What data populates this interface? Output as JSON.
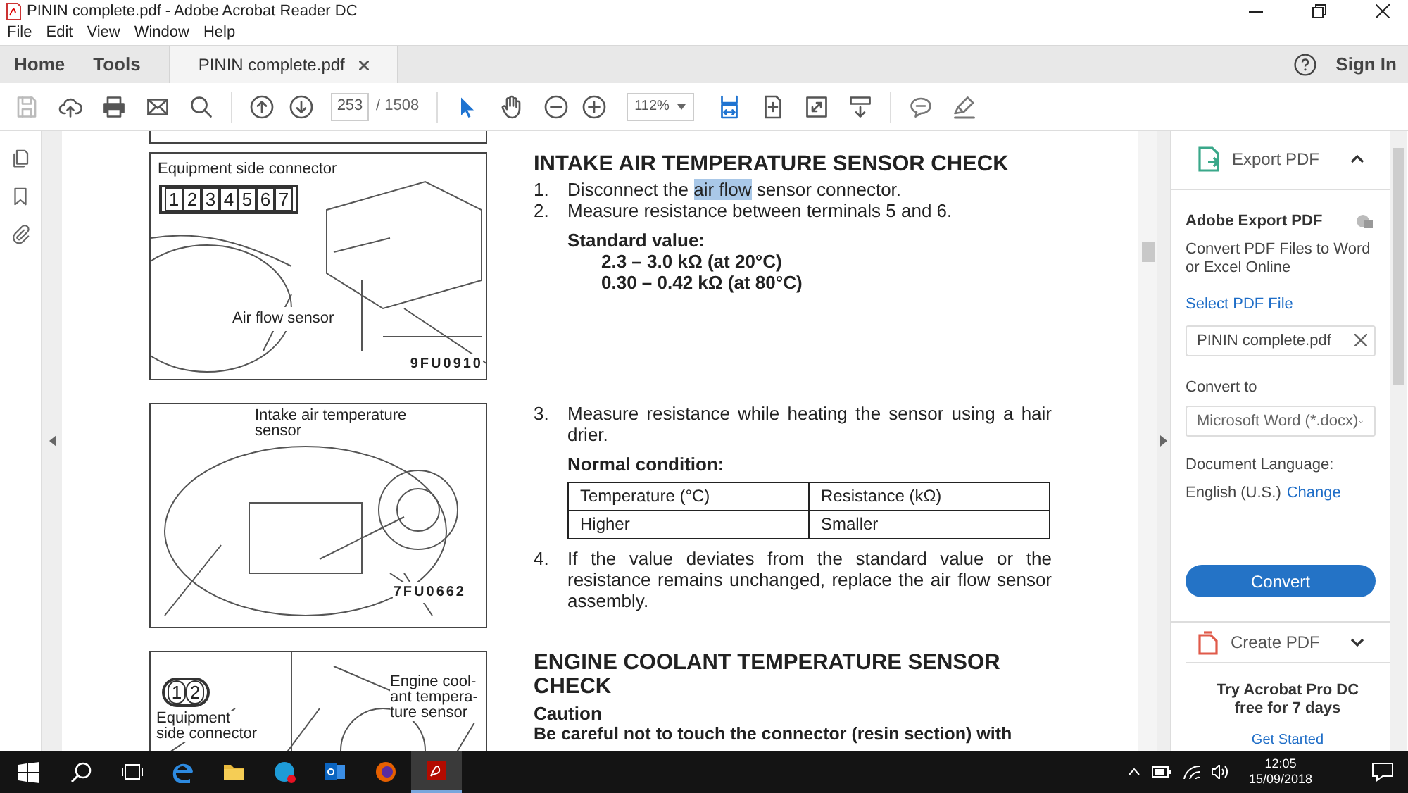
{
  "window": {
    "title": "PININ complete.pdf - Adobe Acrobat Reader DC"
  },
  "menu": [
    "File",
    "Edit",
    "View",
    "Window",
    "Help"
  ],
  "tabs": [
    {
      "label": "Home",
      "selected": false
    },
    {
      "label": "Tools",
      "selected": false
    },
    {
      "label": "PININ complete.pdf",
      "selected": true
    }
  ],
  "account": {
    "sign_in": "Sign In"
  },
  "toolbar": {
    "file_tools": [
      {
        "kind": "save",
        "disabled": true
      },
      {
        "kind": "upload",
        "disabled": false
      },
      {
        "kind": "print",
        "disabled": false
      },
      {
        "kind": "mail",
        "disabled": false
      },
      {
        "kind": "search",
        "disabled": false
      }
    ],
    "nav_tools": [
      {
        "kind": "up"
      },
      {
        "kind": "down"
      }
    ],
    "page": "253",
    "page_count": "/ 1508",
    "pointer_tools": [
      {
        "kind": "select",
        "selected": true
      },
      {
        "kind": "hand",
        "selected": false
      }
    ],
    "zoom_tools": [
      {
        "kind": "zoom-out"
      },
      {
        "kind": "zoom-in"
      }
    ],
    "zoom": "112%",
    "view_tools": [
      {
        "kind": "fit-width",
        "selected": true
      },
      {
        "kind": "fit-page",
        "selected": false
      },
      {
        "kind": "full-screen",
        "selected": false
      },
      {
        "kind": "scroll",
        "selected": false
      }
    ],
    "markup_tools": [
      {
        "kind": "comment"
      },
      {
        "kind": "highlight"
      }
    ]
  },
  "left_rail": [
    {
      "kind": "pages"
    },
    {
      "kind": "bookmark"
    },
    {
      "kind": "attachment"
    }
  ],
  "document": {
    "sections": [
      {
        "figure": {
          "labels": [
            "Equipment side connector",
            "Air flow sensor"
          ],
          "pins": [
            "1",
            "2",
            "3",
            "4",
            "5",
            "6",
            "7"
          ],
          "code": "9FU0910"
        },
        "heading": "INTAKE AIR TEMPERATURE SENSOR CHECK",
        "blocks": [
          {
            "kind": "step",
            "number": "1.",
            "parts": [
              {
                "text": "Disconnect the ",
                "highlighted": false
              },
              {
                "text": "air flow",
                "highlighted": true
              },
              {
                "text": " sensor connector.",
                "highlighted": false
              }
            ]
          },
          {
            "kind": "step",
            "number": "2.",
            "parts": [
              {
                "text": "Measure resistance between terminals 5 and 6.",
                "highlighted": false
              }
            ]
          },
          {
            "kind": "label",
            "text": "Standard value:"
          },
          {
            "kind": "value",
            "text": "2.3 – 3.0 kΩ (at 20°C)"
          },
          {
            "kind": "value",
            "text": "0.30 – 0.42 kΩ (at 80°C)"
          }
        ]
      },
      {
        "figure": {
          "labels": [
            "Intake air temperature\nsensor"
          ],
          "code": "7FU0662"
        },
        "blocks": [
          {
            "kind": "step",
            "number": "3.",
            "parts": [
              {
                "text": "Measure resistance while heating the sensor using a hair drier.",
                "highlighted": false
              }
            ]
          },
          {
            "kind": "label",
            "text": "Normal condition:"
          },
          {
            "kind": "table",
            "rows": [
              [
                "Temperature (°C)",
                "Resistance (kΩ)"
              ],
              [
                "Higher",
                "Smaller"
              ]
            ]
          },
          {
            "kind": "step",
            "number": "4.",
            "parts": [
              {
                "text": "If the value deviates from the standard value or the resistance remains unchanged, replace the air flow sensor assembly.",
                "highlighted": false
              }
            ]
          }
        ]
      },
      {
        "figure": {
          "labels": [
            "Equipment\nside connector",
            "Engine cool-\nant tempera-\nture sensor"
          ],
          "pins": [
            "1",
            "2"
          ]
        },
        "heading": "ENGINE COOLANT TEMPERATURE SENSOR CHECK",
        "blocks": [
          {
            "kind": "label",
            "text": "Caution"
          },
          {
            "kind": "caution",
            "text": "Be careful not to touch the connector (resin section) with"
          }
        ]
      }
    ]
  },
  "panel": {
    "export": {
      "title": "Export PDF",
      "expanded": true,
      "heading": "Adobe Export PDF",
      "description": "Convert PDF Files to Word or Excel Online",
      "select_link": "Select PDF File",
      "file": "PININ complete.pdf",
      "convert_to_label": "Convert to",
      "format": "Microsoft Word (*.docx)",
      "language_label": "Document Language:",
      "language": "English (U.S.)",
      "change_link": "Change",
      "button": "Convert"
    },
    "create": {
      "title": "Create PDF",
      "expanded": false
    },
    "promo": {
      "text": "Try Acrobat Pro DC free for 7 days",
      "link": "Get Started"
    }
  },
  "taskbar": {
    "apps": [
      {
        "kind": "search",
        "selected": false
      },
      {
        "kind": "task-view",
        "selected": false
      },
      {
        "kind": "edge",
        "selected": false
      },
      {
        "kind": "explorer",
        "selected": false
      },
      {
        "kind": "skype",
        "selected": false
      },
      {
        "kind": "outlook",
        "selected": false
      },
      {
        "kind": "firefox",
        "selected": false
      },
      {
        "kind": "acrobat",
        "selected": true
      }
    ],
    "time": "12:05",
    "date": "15/09/2018"
  }
}
